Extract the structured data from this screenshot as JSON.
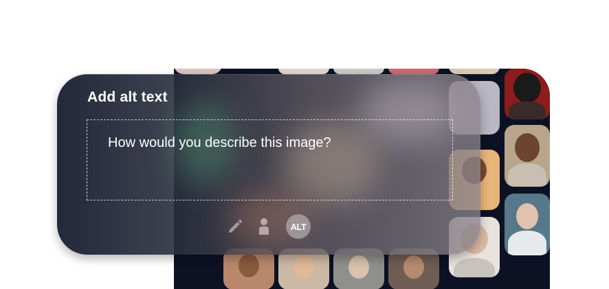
{
  "dialog": {
    "title": "Add alt text",
    "input_placeholder": "How would you describe this image?"
  },
  "toolbar": {
    "items": [
      {
        "icon": "pencil-icon"
      },
      {
        "icon": "person-icon"
      },
      {
        "icon": "alt-icon",
        "label": "ALT"
      }
    ]
  },
  "colors": {
    "gallery_background": "#0c1224",
    "card_dark": "#1c2234",
    "text": "#ffffff"
  }
}
